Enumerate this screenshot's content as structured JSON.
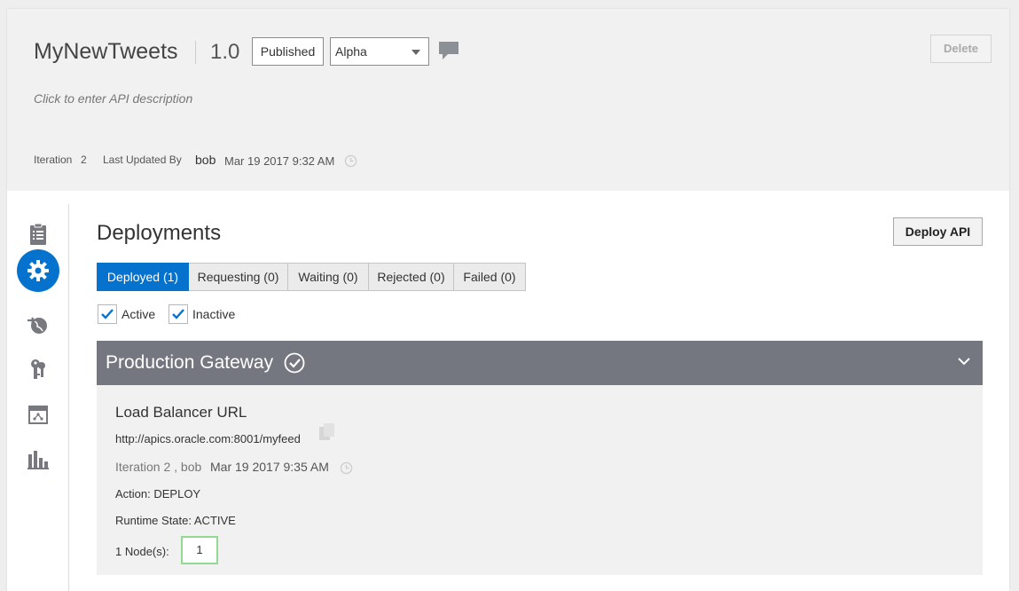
{
  "header": {
    "api_name": "MyNewTweets",
    "version": "1.0",
    "state_button": "Published",
    "state_select": {
      "value": "Alpha"
    },
    "delete_label": "Delete",
    "description_placeholder": "Click to enter API description",
    "iteration_label": "Iteration",
    "iteration_value": "2",
    "last_updated_label": "Last Updated By",
    "last_updated_user": "bob",
    "last_updated_time": "Mar 19 2017 9:32 AM"
  },
  "sidebar": {
    "items": [
      {
        "icon": "api-overview-icon",
        "active": false
      },
      {
        "icon": "settings-gear-icon",
        "active": true
      },
      {
        "icon": "publish-globe-icon",
        "active": false
      },
      {
        "icon": "keys-icon",
        "active": false
      },
      {
        "icon": "calendar-icon",
        "active": false
      },
      {
        "icon": "analytics-icon",
        "active": false
      }
    ]
  },
  "deployments": {
    "title": "Deployments",
    "deploy_button": "Deploy API",
    "tabs": [
      {
        "label": "Deployed (1)",
        "active": true
      },
      {
        "label": "Requesting (0)",
        "active": false
      },
      {
        "label": "Waiting (0)",
        "active": false
      },
      {
        "label": "Rejected (0)",
        "active": false
      },
      {
        "label": "Failed (0)",
        "active": false
      }
    ],
    "filters": [
      {
        "label": "Active",
        "checked": true
      },
      {
        "label": "Inactive",
        "checked": true
      }
    ]
  },
  "gateway": {
    "name": "Production Gateway",
    "lb_title": "Load Balancer URL",
    "lb_url": "http://apics.oracle.com:8001/myfeed",
    "iteration_text": "Iteration 2 , bob",
    "deployed_time": "Mar 19 2017 9:35 AM",
    "action_text": "Action: DEPLOY",
    "runtime_text": "Runtime State: ACTIVE",
    "nodes_label": "1 Node(s):",
    "nodes_value": "1"
  },
  "colors": {
    "accent": "#0572ce",
    "gateway_bar": "#747680",
    "header_bg": "#f1f1f1",
    "nodes_border": "#8fdb8f"
  }
}
